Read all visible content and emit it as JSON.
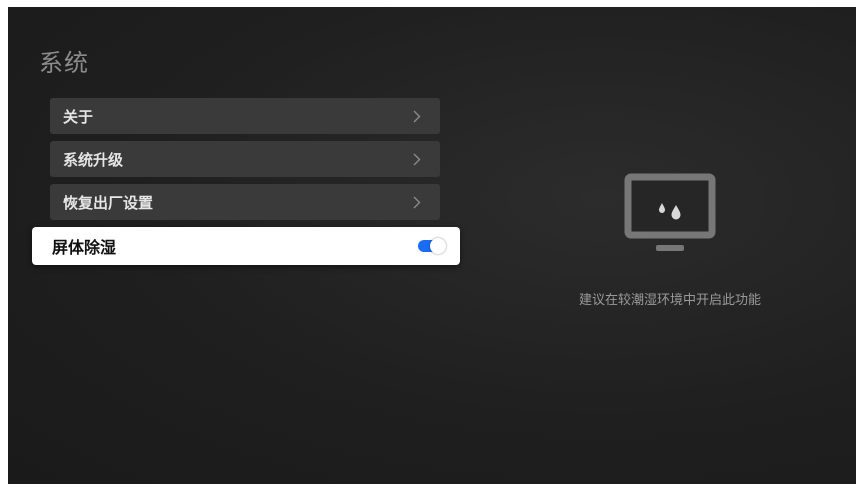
{
  "page": {
    "title": "系统"
  },
  "menu": {
    "items": [
      {
        "label": "关于"
      },
      {
        "label": "系统升级"
      },
      {
        "label": "恢复出厂设置"
      },
      {
        "label": "屏体除湿",
        "toggle_on": true
      }
    ]
  },
  "detail": {
    "hint": "建议在较潮湿环境中开启此功能",
    "icon": "tv-water-drops-icon"
  },
  "colors": {
    "background": "#1f1f1f",
    "menu_item_bg": "#3a3a3a",
    "selected_item_bg": "#ffffff",
    "toggle_accent": "#1a6cf2",
    "title_text": "#8c8c8c",
    "hint_text": "#9a9a9a"
  }
}
